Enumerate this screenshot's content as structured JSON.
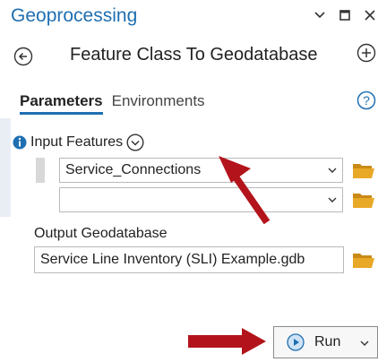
{
  "window": {
    "title": "Geoprocessing",
    "controls": [
      "chevron-down-icon",
      "restore-icon",
      "close-icon"
    ]
  },
  "tool": {
    "title": "Feature Class To Geodatabase",
    "back_icon": "back-arrow-icon",
    "add_icon": "add-circle-icon"
  },
  "tabs": {
    "parameters": "Parameters",
    "environments": "Environments",
    "help_icon": "help-icon"
  },
  "input_features": {
    "label": "Input Features",
    "info_icon": "info-icon",
    "toggle_icon": "chevron-down-circle-icon",
    "rows": [
      {
        "value": "Service_Connections"
      },
      {
        "value": ""
      }
    ]
  },
  "output_geodatabase": {
    "label": "Output Geodatabase",
    "value": "Service Line Inventory (SLI) Example.gdb"
  },
  "run": {
    "label": "Run",
    "icon": "play-icon",
    "caret_icon": "chevron-down-icon"
  },
  "colors": {
    "accent": "#1f6fb2",
    "folder": "#e0a325",
    "annotation_arrow": "#b3141b"
  }
}
